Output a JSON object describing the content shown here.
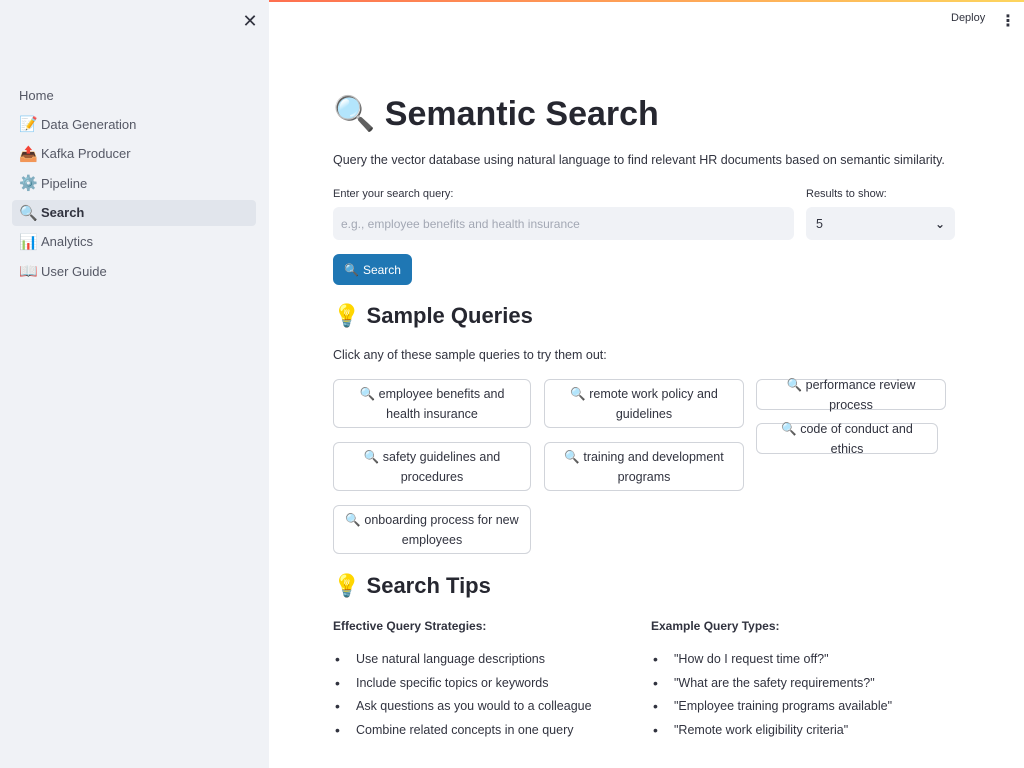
{
  "sidebar": {
    "close_icon": "✕",
    "items": [
      {
        "label": "Home",
        "icon": ""
      },
      {
        "label": "Data Generation",
        "icon": "📝"
      },
      {
        "label": "Kafka Producer",
        "icon": "📤"
      },
      {
        "label": "Pipeline",
        "icon": "⚙️"
      },
      {
        "label": "Search",
        "icon": "🔍",
        "active": true
      },
      {
        "label": "Analytics",
        "icon": "📊"
      },
      {
        "label": "User Guide",
        "icon": "📖"
      }
    ]
  },
  "header": {
    "deploy_label": "Deploy",
    "menu_icon": "⋮"
  },
  "main": {
    "title_icon": "🔍",
    "title": "Semantic Search",
    "description": "Query the vector database using natural language to find relevant HR documents based on semantic similarity.",
    "query_label": "Enter your search query:",
    "query_placeholder": "e.g., employee benefits and health insurance",
    "query_value": "",
    "results_label": "Results to show:",
    "results_value": "5",
    "search_button": {
      "icon": "🔍",
      "label": "Search"
    }
  },
  "samples": {
    "heading_icon": "💡",
    "heading": "Sample Queries",
    "subtext": "Click any of these sample queries to try them out:",
    "icon": "🔍",
    "queries": [
      "employee benefits and health insurance",
      "remote work policy and guidelines",
      "performance review process",
      "safety guidelines and procedures",
      "training and development programs",
      "code of conduct and ethics",
      "onboarding process for new employees"
    ]
  },
  "tips": {
    "heading_icon": "💡",
    "heading": "Search Tips",
    "left_title": "Effective Query Strategies:",
    "left_items": [
      "Use natural language descriptions",
      "Include specific topics or keywords",
      "Ask questions as you would to a colleague",
      "Combine related concepts in one query"
    ],
    "right_title": "Example Query Types:",
    "right_items": [
      "\"How do I request time off?\"",
      "\"What are the safety requirements?\"",
      "\"Employee training programs available\"",
      "\"Remote work eligibility criteria\""
    ]
  },
  "colors": {
    "accent": "#1f77b4",
    "sidebar_bg": "#f0f2f6",
    "text": "#31333f"
  }
}
